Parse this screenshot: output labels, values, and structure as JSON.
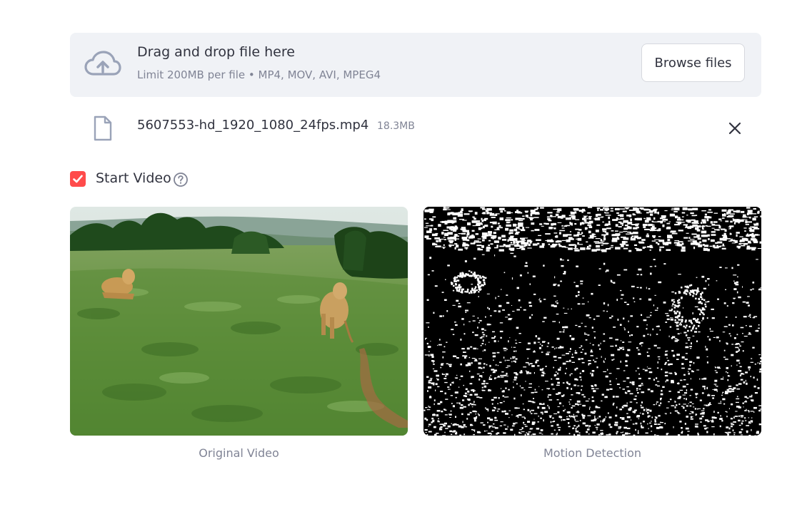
{
  "uploader": {
    "title": "Drag and drop file here",
    "limit": "Limit 200MB per file • MP4, MOV, AVI, MPEG4",
    "browse_label": "Browse files",
    "icon": "cloud-upload-icon"
  },
  "file": {
    "name": "5607553-hd_1920_1080_24fps.mp4",
    "size": "18.3MB",
    "icon": "file-icon",
    "remove_icon": "close-icon"
  },
  "toggle": {
    "label": "Start Video",
    "checked": true,
    "help_icon": "help-circle-icon"
  },
  "videos": [
    {
      "caption": "Original Video"
    },
    {
      "caption": "Motion Detection"
    }
  ],
  "colors": {
    "accent": "#ff4b4b",
    "uploader_bg": "#f0f2f6",
    "text": "#31333f",
    "muted": "#808495"
  }
}
